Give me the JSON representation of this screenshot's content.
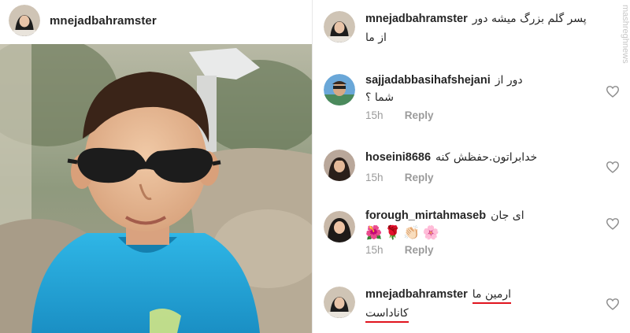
{
  "post": {
    "username": "mnejadbahramster"
  },
  "watermark": "mashreghnews",
  "comments": [
    {
      "username": "mnejadbahramster",
      "text_line1": "پسر گلم بزرگ میشه دور",
      "text_line2": "از ما"
    },
    {
      "username": "sajjadabbasihafshejani",
      "text_line1": "دور از",
      "text_line2": "شما ؟",
      "age": "15h",
      "reply": "Reply"
    },
    {
      "username": "hoseini8686",
      "text_line1": "خدابراتون.حفظش کنه",
      "age": "15h",
      "reply": "Reply"
    },
    {
      "username": "forough_mirtahmaseb",
      "text_line1": "ای جان",
      "emojis": "🌺🌹👏🏻🌸",
      "age": "15h",
      "reply": "Reply"
    },
    {
      "username": "mnejadbahramster",
      "text_line1": "ارمین ما",
      "text_line2": "کاناداست"
    }
  ],
  "colors": {
    "text": "#262626",
    "muted": "#9b9b9b",
    "underline": "#e0141e"
  }
}
